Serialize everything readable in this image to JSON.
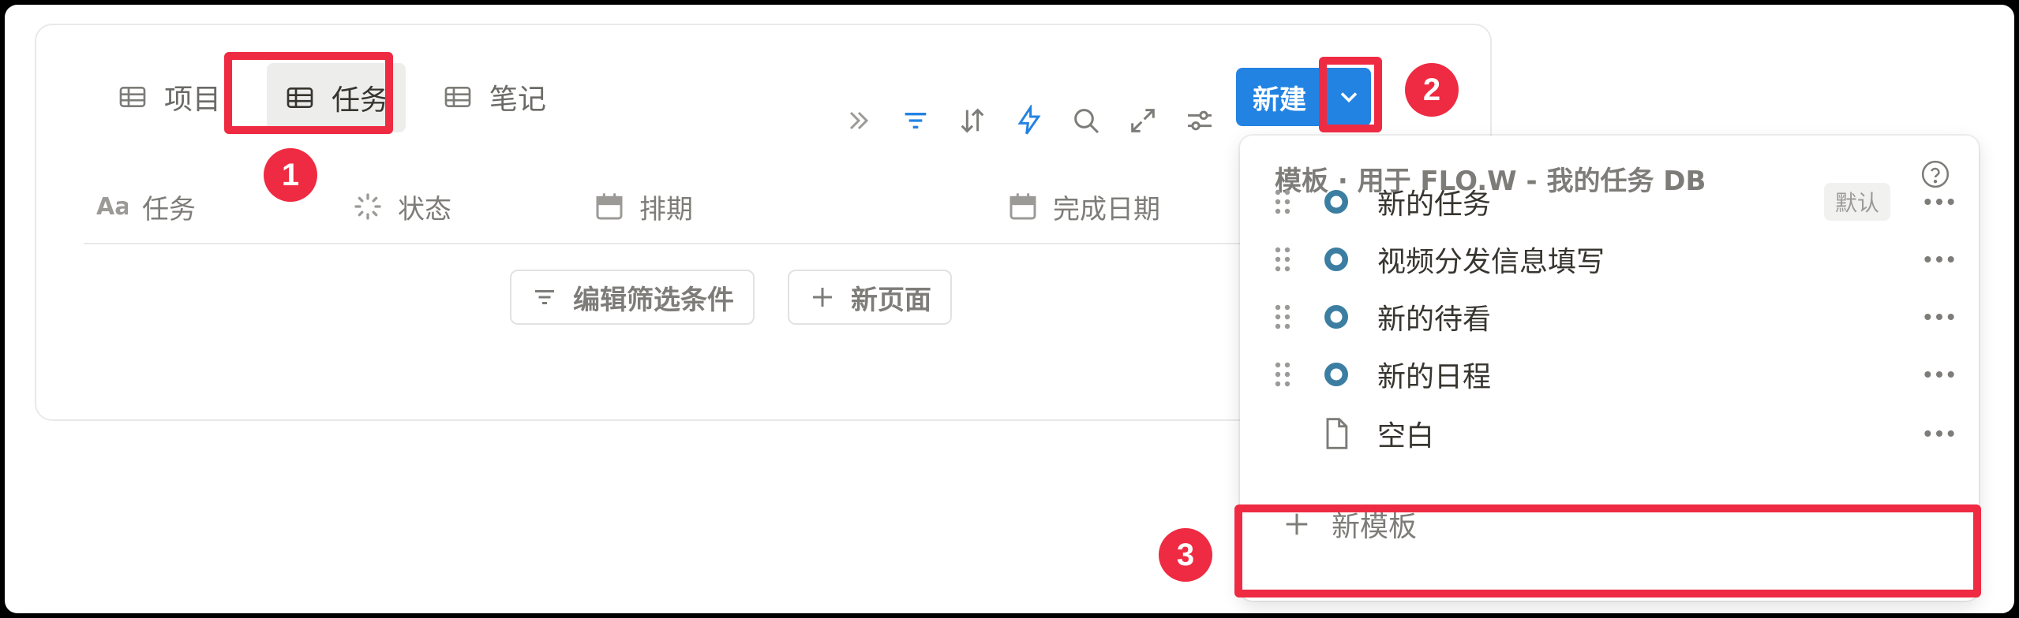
{
  "tabs": [
    {
      "label": "项目",
      "icon": "table-icon"
    },
    {
      "label": "任务",
      "icon": "table-icon",
      "active": true
    },
    {
      "label": "笔记",
      "icon": "table-icon"
    }
  ],
  "toolbar": {
    "icons": [
      "double-chevron-right-icon",
      "filter-icon",
      "sort-icon",
      "lightning-icon",
      "search-icon",
      "expand-icon",
      "settings-sliders-icon"
    ],
    "new_label": "新建",
    "accent": "#2383e2"
  },
  "columns": [
    {
      "label": "任务",
      "icon": "text-aa-icon"
    },
    {
      "label": "状态",
      "icon": "status-spinner-icon"
    },
    {
      "label": "排期",
      "icon": "calendar-icon"
    },
    {
      "label": "完成日期",
      "icon": "calendar-icon"
    }
  ],
  "empty_actions": {
    "edit_filter": "编辑筛选条件",
    "new_page": "新页面"
  },
  "dropdown": {
    "title": "模板 · 用于 FLO.W - 我的任务 DB",
    "items": [
      {
        "label": "新的任务",
        "badge": "默认"
      },
      {
        "label": "视频分发信息填写"
      },
      {
        "label": "新的待看"
      },
      {
        "label": "新的日程"
      },
      {
        "label": "空白"
      }
    ],
    "new_template": "新模板"
  },
  "markers": [
    "1",
    "2",
    "3"
  ],
  "highlight_color": "#ee2b42"
}
